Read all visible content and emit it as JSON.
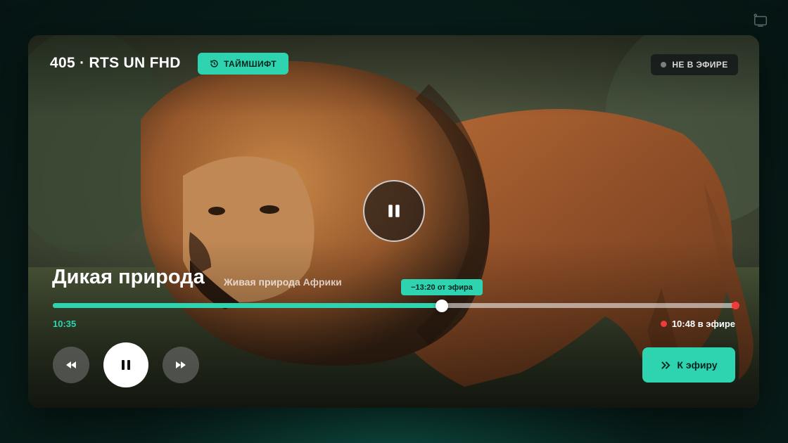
{
  "app": {
    "corner_icon": "tv-icon"
  },
  "player": {
    "channel": "405 · RTS UN FHD",
    "timeshift_label": "ТАЙМШИФТ",
    "live_status": "НЕ В ЭФИРЕ",
    "program_title": "Дикая природа",
    "program_subtitle": "Живая природа Африки",
    "offset_tooltip": "−13:20 от эфира",
    "start_time": "10:35",
    "live_time": "10:48 в эфире",
    "progress": 0.57,
    "to_live_label": "К эфиру"
  },
  "colors": {
    "accent": "#2ed3b0",
    "live": "#ef3b3b"
  }
}
